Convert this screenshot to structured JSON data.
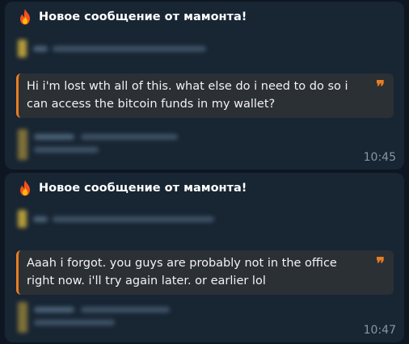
{
  "colors": {
    "background": "#0e1621",
    "bubble": "#182533",
    "quote_bg": "#2b3035",
    "quote_accent": "#e67e22",
    "time_text": "#8597a8"
  },
  "messages": [
    {
      "icon": "fire-icon",
      "title": "Новое сообщение от мамонта!",
      "quote": "Hi i'm lost wth all of this.  what else do i need to do so i can access the bitcoin funds in my wallet?",
      "quote_mark": "❞",
      "time": "10:45"
    },
    {
      "icon": "fire-icon",
      "title": "Новое сообщение от мамонта!",
      "quote": "Aaah i forgot.  you guys are probably not in the office right now.  i'll try again later.  or earlier lol",
      "quote_mark": "❞",
      "time": "10:47"
    }
  ]
}
